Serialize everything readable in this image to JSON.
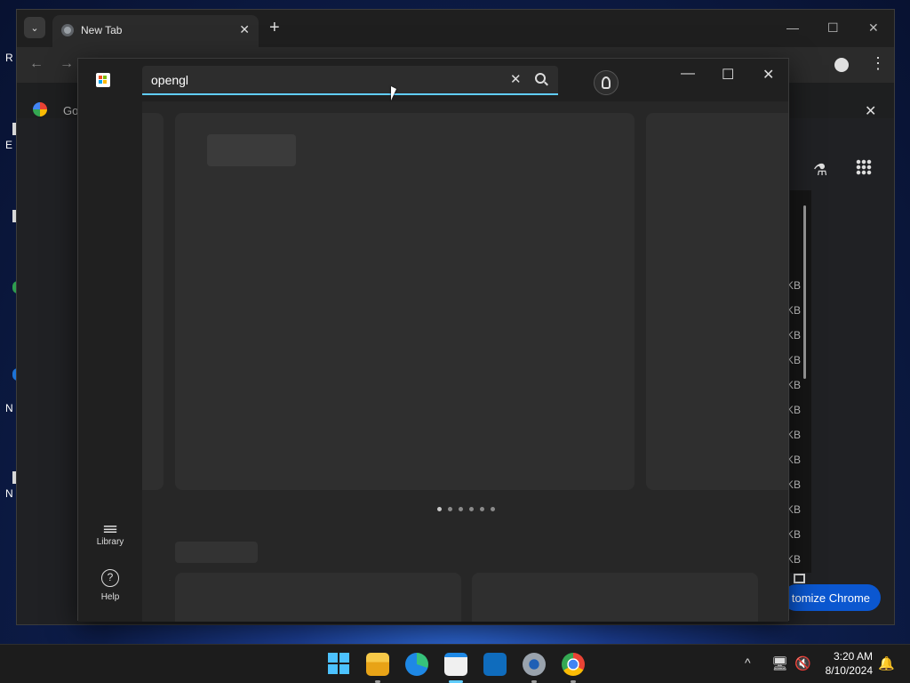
{
  "desktop": {
    "fragments": [
      "R",
      "E",
      "N",
      "N"
    ]
  },
  "chrome": {
    "tab_title": "New Tab",
    "new_tab_symbol": "+",
    "bookmark_text": "Go",
    "kb_suffix": [
      "KB",
      "KB",
      "KB",
      "KB",
      "KB",
      "KB",
      "KB",
      "KB",
      "KB",
      "KB",
      "KB",
      "KB"
    ],
    "customize_label": "tomize Chrome"
  },
  "store": {
    "search": {
      "value": "opengl"
    },
    "nav": {
      "library_label": "Library",
      "help_label": "Help",
      "help_symbol": "?"
    },
    "carousel": {
      "dot_count": 6,
      "active_index": 0
    }
  },
  "taskbar": {
    "apps": [
      "start",
      "file-explorer",
      "edge",
      "microsoft-store",
      "outlook",
      "settings",
      "chrome"
    ],
    "active_app": "microsoft-store",
    "time": "3:20 AM",
    "date": "8/10/2024"
  },
  "icons": {
    "close": "✕",
    "minimize": "—",
    "maximize": "☐",
    "back": "←",
    "forward": "→",
    "menu": "⋮",
    "chevron_up": "^",
    "bell": "🔔"
  },
  "colors": {
    "accent": "#60cdff",
    "chrome_blue": "#0b57d0",
    "store_bg": "#202020",
    "content_bg": "#272727"
  }
}
